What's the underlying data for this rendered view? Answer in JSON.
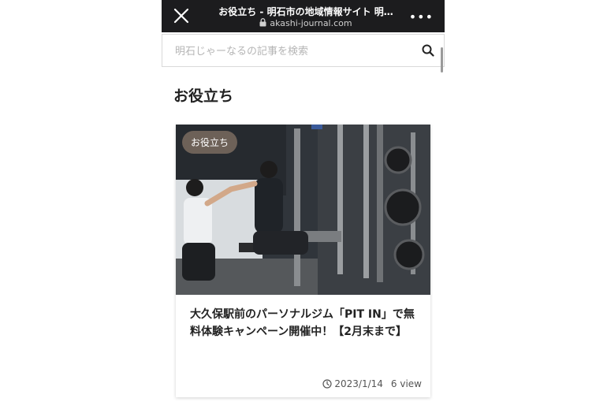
{
  "browser": {
    "page_title": "お役立ち - 明石市の地域情報サイト 明…",
    "url": "akashi-journal.com",
    "more_label": "•••"
  },
  "search": {
    "placeholder": "明石じゃーなるの記事を検索",
    "value": ""
  },
  "section": {
    "heading": "お役立ち"
  },
  "article": {
    "category": "お役立ち",
    "title": "大久保駅前のパーソナルジム「PIT IN」で無料体験キャンペーン開催中！【2月末まで】",
    "date": "2023/1/14",
    "views": "6 view"
  },
  "colors": {
    "topbar": "#1c1c1e",
    "badge": "#78695f"
  }
}
